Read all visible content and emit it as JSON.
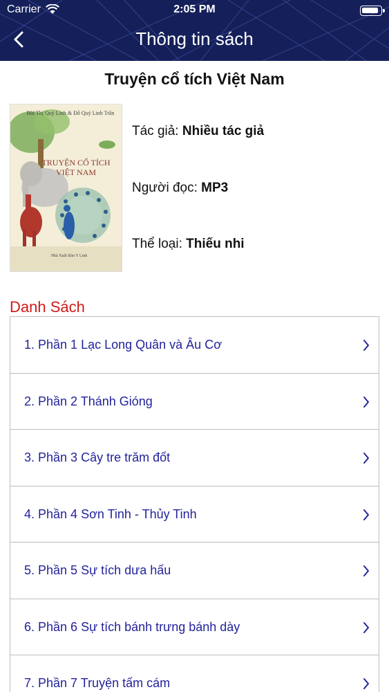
{
  "status_bar": {
    "carrier": "Carrier",
    "time": "2:05 PM"
  },
  "nav": {
    "title": "Thông tin sách",
    "back_icon": "chevron-left-icon"
  },
  "book": {
    "title": "Truyện cổ tích Việt Nam",
    "cover": {
      "title_line1": "TRUYỆN CỔ TÍCH",
      "title_line2": "VIỆT NAM",
      "authors": "Bùi Thị Quý Linh & Đỗ Quý Linh Trân",
      "publisher": "Nhà Xuất Bản Y Linh"
    },
    "author_label": "Tác giả:",
    "author_value": "Nhiều tác giả",
    "reader_label": "Người đọc:",
    "reader_value": "MP3",
    "genre_label": "Thể loại:",
    "genre_value": "Thiếu nhi"
  },
  "list": {
    "title": "Danh Sách",
    "items": [
      "1. Phần 1 Lạc Long Quân và Âu Cơ",
      "2. Phần 2 Thánh Gióng",
      "3. Phần 3 Cây tre trăm đốt",
      "4. Phần 4 Sơn Tinh - Thủy Tinh",
      "5. Phần 5 Sự tích dưa hấu",
      "6. Phần 6 Sự tích bánh trưng bánh dày",
      "7. Phần 7 Truyện tấm cám"
    ]
  },
  "colors": {
    "header_bg": "#15205a",
    "section_title": "#d11a1a",
    "list_text": "#23239b"
  }
}
